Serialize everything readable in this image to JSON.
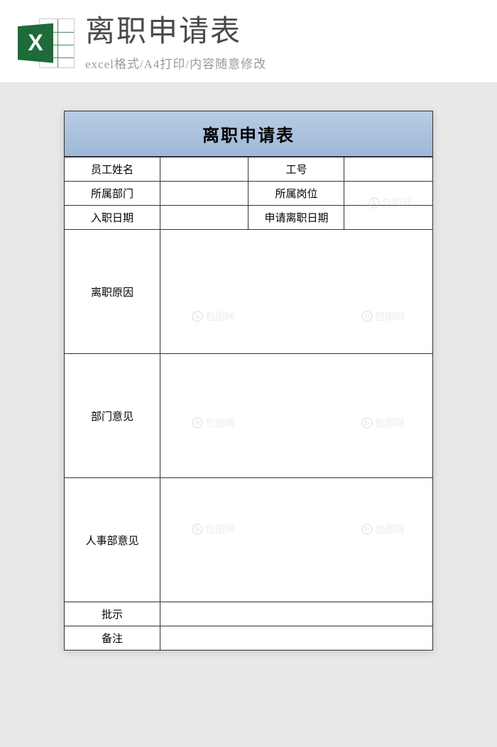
{
  "header": {
    "icon_letter": "X",
    "title": "离职申请表",
    "subtitle": "excel格式/A4打印/内容随意修改"
  },
  "document": {
    "title": "离职申请表",
    "fields": {
      "employee_name_label": "员工姓名",
      "employee_name_value": "",
      "employee_id_label": "工号",
      "employee_id_value": "",
      "department_label": "所属部门",
      "department_value": "",
      "position_label": "所属岗位",
      "position_value": "",
      "hire_date_label": "入职日期",
      "hire_date_value": "",
      "resign_date_label": "申请离职日期",
      "resign_date_value": "",
      "reason_label": "离职原因",
      "reason_value": "",
      "dept_opinion_label": "部门意见",
      "dept_opinion_value": "",
      "hr_opinion_label": "人事部意见",
      "hr_opinion_value": "",
      "approval_label": "批示",
      "approval_value": "",
      "remarks_label": "备注",
      "remarks_value": ""
    }
  },
  "watermark": {
    "text": "包图网",
    "icon": "b"
  }
}
